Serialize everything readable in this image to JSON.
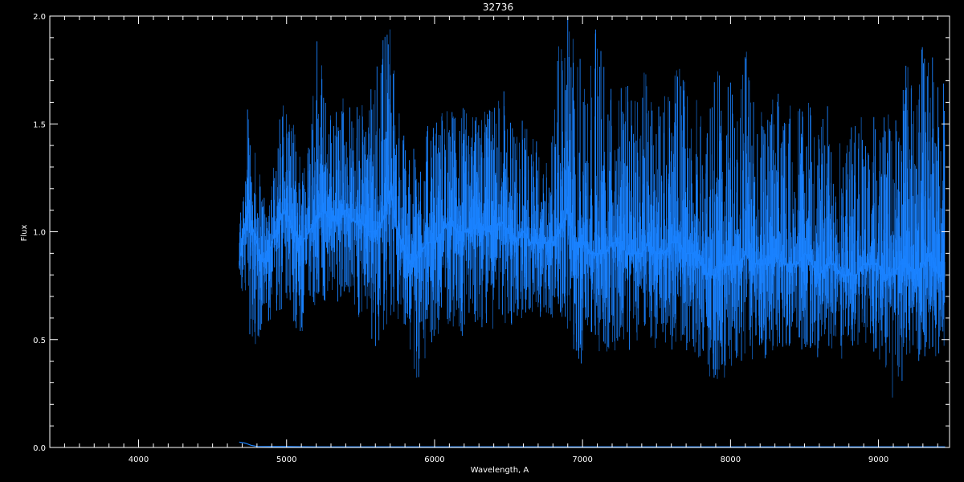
{
  "chart_data": {
    "type": "line",
    "title": "32736",
    "xlabel": "Wavelength, A",
    "ylabel": "Flux",
    "xlim": [
      3400,
      9480
    ],
    "ylim": [
      0,
      2.0
    ],
    "xticks": [
      4000,
      5000,
      6000,
      7000,
      8000,
      9000
    ],
    "xtick_labels": [
      "4000",
      "5000",
      "6000",
      "7000",
      "8000",
      "9000"
    ],
    "yticks": [
      0.0,
      0.5,
      1.0,
      1.5,
      2.0
    ],
    "ytick_labels": [
      "0.0",
      "0.5",
      "1.0",
      "1.5",
      "2.0"
    ],
    "grid": false,
    "background": "#000000",
    "axis_color": "#ffffff",
    "series": [
      {
        "color": "#1a82ff",
        "x": [
          4680,
          4700,
          4740,
          4780,
          4820,
          4860,
          4900,
          4950,
          5000,
          5050,
          5100,
          5150,
          5200,
          5250,
          5300,
          5350,
          5400,
          5450,
          5500,
          5550,
          5600,
          5650,
          5700,
          5750,
          5800,
          5850,
          5900,
          5950,
          6000,
          6050,
          6100,
          6150,
          6200,
          6250,
          6300,
          6350,
          6400,
          6450,
          6500,
          6550,
          6600,
          6650,
          6700,
          6750,
          6800,
          6850,
          6900,
          6950,
          7000,
          7050,
          7100,
          7150,
          7200,
          7250,
          7300,
          7350,
          7400,
          7450,
          7500,
          7550,
          7600,
          7650,
          7700,
          7750,
          7800,
          7850,
          7900,
          7950,
          8000,
          8050,
          8100,
          8150,
          8200,
          8250,
          8300,
          8350,
          8400,
          8450,
          8500,
          8550,
          8600,
          8650,
          8700,
          8750,
          8800,
          8850,
          8900,
          8950,
          9000,
          9050,
          9100,
          9150,
          9200,
          9250,
          9300,
          9350,
          9400,
          9450
        ],
        "y": [
          0.85,
          0.95,
          1.1,
          1.0,
          0.9,
          0.85,
          0.95,
          1.05,
          1.1,
          1.0,
          0.95,
          1.0,
          1.05,
          1.1,
          1.05,
          1.05,
          1.1,
          1.05,
          1.05,
          1.0,
          1.0,
          1.05,
          1.2,
          1.0,
          0.9,
          0.85,
          0.9,
          0.95,
          0.95,
          1.0,
          1.05,
          1.0,
          1.0,
          1.0,
          1.05,
          1.0,
          1.0,
          1.05,
          1.0,
          0.95,
          1.0,
          0.95,
          0.95,
          0.95,
          0.95,
          1.0,
          1.1,
          0.95,
          0.95,
          0.9,
          0.9,
          0.9,
          0.95,
          0.95,
          0.9,
          0.9,
          0.9,
          0.95,
          0.9,
          0.9,
          0.95,
          0.95,
          0.9,
          0.9,
          0.85,
          0.8,
          0.8,
          0.85,
          0.85,
          0.85,
          0.9,
          0.85,
          0.85,
          0.85,
          0.9,
          0.85,
          0.85,
          0.85,
          0.9,
          0.85,
          0.8,
          0.85,
          0.85,
          0.8,
          0.8,
          0.8,
          0.85,
          0.85,
          0.85,
          0.8,
          0.8,
          0.85,
          0.85,
          0.8,
          0.85,
          0.9,
          0.8,
          0.8
        ],
        "noise_min": [
          0.8,
          0.65,
          0.55,
          0.45,
          0.45,
          0.55,
          0.6,
          0.6,
          0.6,
          0.55,
          0.5,
          0.6,
          0.65,
          0.65,
          0.65,
          0.65,
          0.7,
          0.6,
          0.6,
          0.55,
          0.45,
          0.5,
          0.55,
          0.55,
          0.5,
          0.4,
          0.25,
          0.45,
          0.5,
          0.55,
          0.55,
          0.55,
          0.5,
          0.55,
          0.55,
          0.55,
          0.55,
          0.6,
          0.55,
          0.55,
          0.6,
          0.6,
          0.6,
          0.6,
          0.6,
          0.6,
          0.45,
          0.4,
          0.35,
          0.45,
          0.45,
          0.4,
          0.45,
          0.45,
          0.45,
          0.45,
          0.45,
          0.5,
          0.45,
          0.45,
          0.45,
          0.45,
          0.45,
          0.45,
          0.4,
          0.35,
          0.2,
          0.3,
          0.35,
          0.4,
          0.4,
          0.4,
          0.4,
          0.4,
          0.45,
          0.4,
          0.45,
          0.45,
          0.45,
          0.45,
          0.4,
          0.45,
          0.45,
          0.4,
          0.45,
          0.4,
          0.45,
          0.45,
          0.4,
          0.35,
          0.2,
          0.3,
          0.35,
          0.4,
          0.4,
          0.45,
          0.4,
          0.4
        ],
        "noise_max": [
          1.05,
          1.3,
          1.6,
          1.4,
          1.3,
          1.2,
          1.3,
          1.55,
          1.7,
          1.5,
          1.4,
          1.5,
          2.0,
          1.7,
          1.6,
          1.6,
          1.7,
          1.6,
          1.6,
          1.6,
          1.8,
          2.0,
          2.0,
          1.6,
          1.45,
          1.4,
          1.4,
          1.5,
          1.5,
          1.6,
          1.6,
          1.55,
          1.6,
          1.55,
          1.6,
          1.6,
          1.6,
          1.7,
          1.6,
          1.5,
          1.55,
          1.5,
          1.4,
          1.4,
          1.45,
          2.0,
          2.0,
          1.9,
          1.9,
          1.8,
          2.0,
          1.9,
          1.8,
          1.8,
          1.7,
          1.7,
          1.75,
          1.8,
          1.7,
          1.7,
          1.8,
          1.8,
          1.75,
          1.7,
          1.65,
          1.6,
          2.0,
          1.7,
          1.7,
          1.6,
          1.9,
          1.7,
          1.6,
          1.55,
          1.7,
          1.6,
          1.6,
          1.6,
          1.7,
          1.65,
          1.55,
          1.6,
          1.6,
          1.55,
          1.55,
          1.5,
          1.6,
          1.6,
          1.55,
          1.6,
          1.55,
          1.7,
          1.9,
          1.6,
          1.9,
          1.9,
          1.7,
          1.7
        ]
      },
      {
        "color": "#1a82ff",
        "x": [
          4680,
          4720,
          4760,
          4800,
          4900,
          5000,
          5200,
          6000,
          7000,
          8000,
          9000,
          9450
        ],
        "y": [
          0.025,
          0.02,
          0.01,
          0.005,
          0.004,
          0.004,
          0.003,
          0.003,
          0.003,
          0.003,
          0.003,
          0.003
        ]
      }
    ]
  }
}
